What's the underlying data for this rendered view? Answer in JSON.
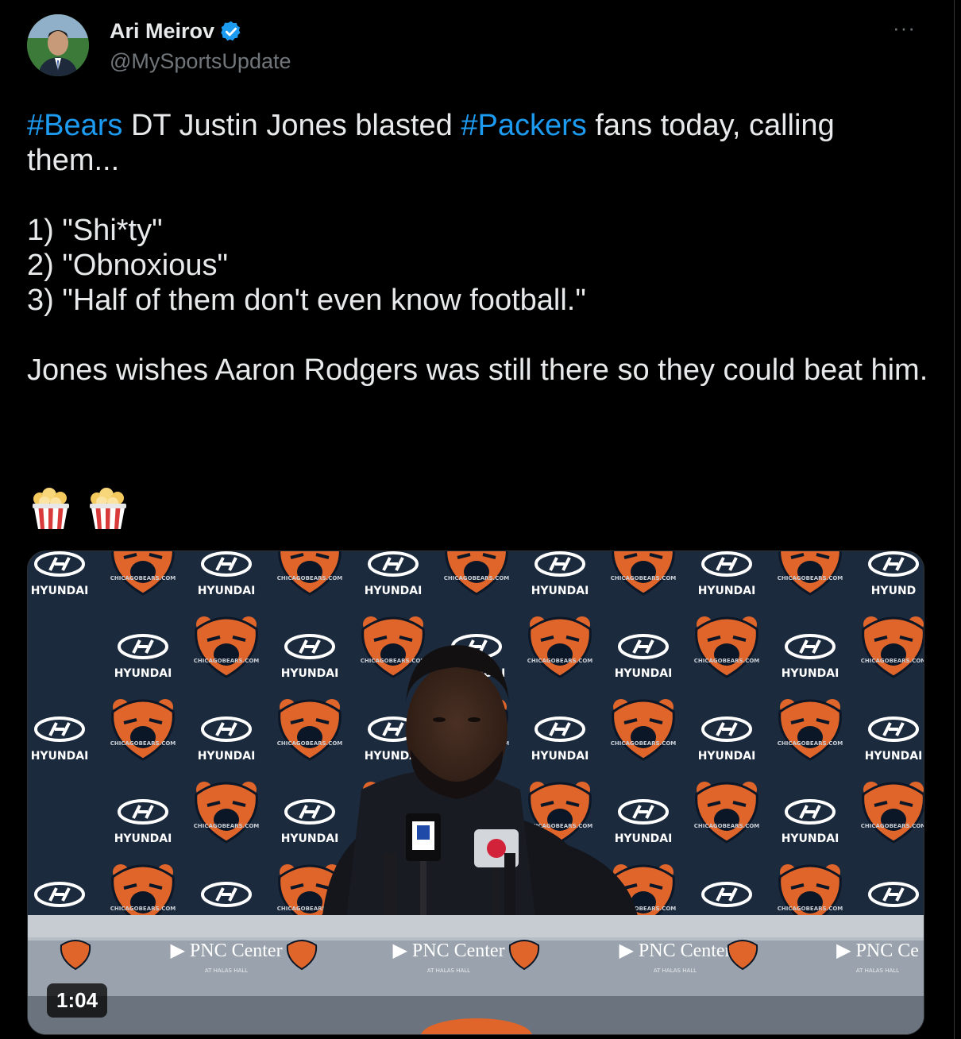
{
  "author": {
    "display_name": "Ari Meirov",
    "handle": "@MySportsUpdate",
    "verified_icon": "verified-badge-icon",
    "avatar_icon": "profile-avatar"
  },
  "menu": {
    "more_label": "···"
  },
  "tweet": {
    "hashtag_bears": "#Bears",
    "text_1": " DT Justin Jones blasted ",
    "hashtag_packers": "#Packers",
    "text_2": " fans today, calling them...\n\n1) \"Shi*ty\"\n2) \"Obnoxious\"\n3) \"Half of them don't even know football.\"\n\nJones wishes Aaron Rodgers was still there so they could beat him.",
    "emojis": [
      "🍿",
      "🍿"
    ]
  },
  "media": {
    "duration": "1:04",
    "sponsor_text": "HYUNDAI",
    "sponsor_partial_text": "HYUND",
    "website_text": "CHICAGOBEARS.COM",
    "table_banner": "PNC Center",
    "table_banner_partial": "PNC Ce",
    "table_banner_sub": "AT HALAS HALL",
    "colors": {
      "backdrop": "#1b2a3d",
      "bear_orange": "#e0652a",
      "table": "#9aa3ad"
    }
  }
}
